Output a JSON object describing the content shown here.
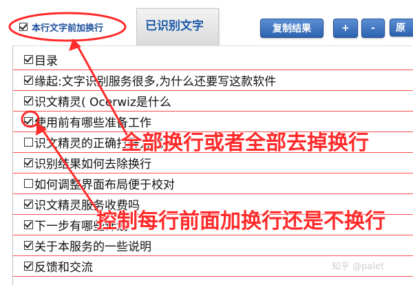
{
  "toolbar": {
    "prepend_label": "本行文字前加换行",
    "prepend_checked": true,
    "tab_label": "已识别文字",
    "copy_label": "复制结果",
    "plus_label": "+",
    "minus_label": "-",
    "orig_label": "原"
  },
  "items": [
    {
      "label": "目录",
      "checked": true
    },
    {
      "label": "缘起:文字识别服务很多,为什么还要写这款软件",
      "checked": true
    },
    {
      "label": "识文精灵( Ocerwiz是什么",
      "checked": true
    },
    {
      "label": "使用前有哪些准备工作",
      "checked": true
    },
    {
      "label": "识文精灵的正确打开方式",
      "checked": false
    },
    {
      "label": "识别结果如何去除换行",
      "checked": true
    },
    {
      "label": "如何调整界面布局便于校对",
      "checked": false
    },
    {
      "label": "识文精灵服务收费吗",
      "checked": true
    },
    {
      "label": "下一步有哪些计划",
      "checked": true
    },
    {
      "label": "关于本服务的一些说明",
      "checked": true
    },
    {
      "label": "反馈和交流",
      "checked": true
    }
  ],
  "annotations": {
    "all_lines": "全部换行或者全部去掉换行",
    "per_line": "控制每行前面加换行还是不换行"
  },
  "watermark": "知乎 @palet",
  "colors": {
    "annotation": "#ff2a2a",
    "button": "#2d62b0",
    "row_divider": "#ff4a4a"
  }
}
